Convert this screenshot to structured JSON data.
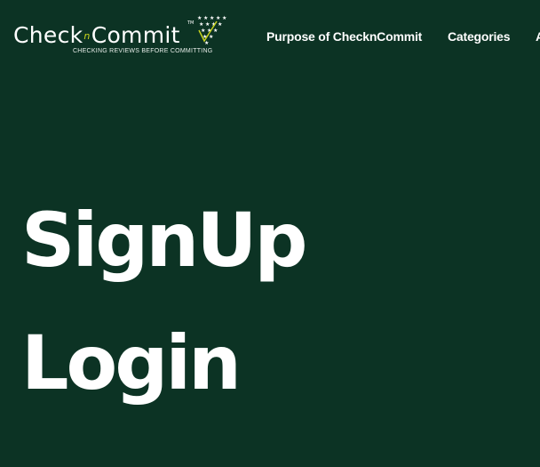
{
  "brand": {
    "name_part1": "Check",
    "name_connector": "n",
    "name_part2": "Commit",
    "trademark": "TM",
    "tagline": "CHECKING REVIEWS BEFORE COMMITTING",
    "primary_color": "#0c3324",
    "accent_color": "#c8d41c"
  },
  "nav": {
    "items": [
      {
        "label": "Purpose of ChecknCommit"
      },
      {
        "label": "Categories"
      },
      {
        "label": "A"
      }
    ]
  },
  "hero": {
    "links": [
      {
        "label": "SignUp"
      },
      {
        "label": "Login"
      }
    ]
  }
}
